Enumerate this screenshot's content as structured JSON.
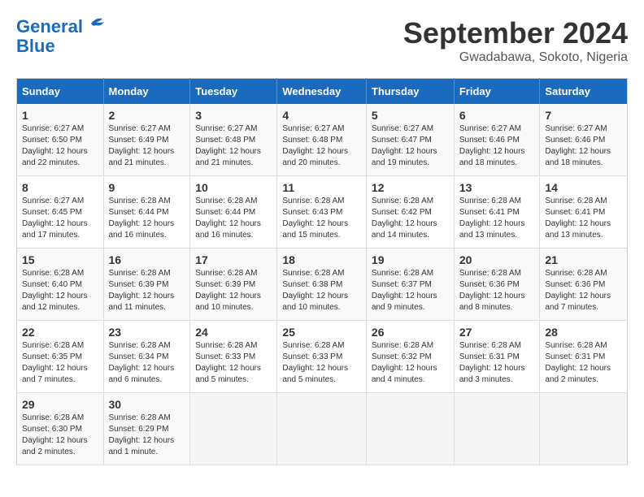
{
  "header": {
    "logo_line1": "General",
    "logo_line2": "Blue",
    "month": "September 2024",
    "location": "Gwadabawa, Sokoto, Nigeria"
  },
  "weekdays": [
    "Sunday",
    "Monday",
    "Tuesday",
    "Wednesday",
    "Thursday",
    "Friday",
    "Saturday"
  ],
  "weeks": [
    [
      {
        "day": "1",
        "sunrise": "6:27 AM",
        "sunset": "6:50 PM",
        "daylight": "12 hours and 22 minutes."
      },
      {
        "day": "2",
        "sunrise": "6:27 AM",
        "sunset": "6:49 PM",
        "daylight": "12 hours and 21 minutes."
      },
      {
        "day": "3",
        "sunrise": "6:27 AM",
        "sunset": "6:48 PM",
        "daylight": "12 hours and 21 minutes."
      },
      {
        "day": "4",
        "sunrise": "6:27 AM",
        "sunset": "6:48 PM",
        "daylight": "12 hours and 20 minutes."
      },
      {
        "day": "5",
        "sunrise": "6:27 AM",
        "sunset": "6:47 PM",
        "daylight": "12 hours and 19 minutes."
      },
      {
        "day": "6",
        "sunrise": "6:27 AM",
        "sunset": "6:46 PM",
        "daylight": "12 hours and 18 minutes."
      },
      {
        "day": "7",
        "sunrise": "6:27 AM",
        "sunset": "6:46 PM",
        "daylight": "12 hours and 18 minutes."
      }
    ],
    [
      {
        "day": "8",
        "sunrise": "6:27 AM",
        "sunset": "6:45 PM",
        "daylight": "12 hours and 17 minutes."
      },
      {
        "day": "9",
        "sunrise": "6:28 AM",
        "sunset": "6:44 PM",
        "daylight": "12 hours and 16 minutes."
      },
      {
        "day": "10",
        "sunrise": "6:28 AM",
        "sunset": "6:44 PM",
        "daylight": "12 hours and 16 minutes."
      },
      {
        "day": "11",
        "sunrise": "6:28 AM",
        "sunset": "6:43 PM",
        "daylight": "12 hours and 15 minutes."
      },
      {
        "day": "12",
        "sunrise": "6:28 AM",
        "sunset": "6:42 PM",
        "daylight": "12 hours and 14 minutes."
      },
      {
        "day": "13",
        "sunrise": "6:28 AM",
        "sunset": "6:41 PM",
        "daylight": "12 hours and 13 minutes."
      },
      {
        "day": "14",
        "sunrise": "6:28 AM",
        "sunset": "6:41 PM",
        "daylight": "12 hours and 13 minutes."
      }
    ],
    [
      {
        "day": "15",
        "sunrise": "6:28 AM",
        "sunset": "6:40 PM",
        "daylight": "12 hours and 12 minutes."
      },
      {
        "day": "16",
        "sunrise": "6:28 AM",
        "sunset": "6:39 PM",
        "daylight": "12 hours and 11 minutes."
      },
      {
        "day": "17",
        "sunrise": "6:28 AM",
        "sunset": "6:39 PM",
        "daylight": "12 hours and 10 minutes."
      },
      {
        "day": "18",
        "sunrise": "6:28 AM",
        "sunset": "6:38 PM",
        "daylight": "12 hours and 10 minutes."
      },
      {
        "day": "19",
        "sunrise": "6:28 AM",
        "sunset": "6:37 PM",
        "daylight": "12 hours and 9 minutes."
      },
      {
        "day": "20",
        "sunrise": "6:28 AM",
        "sunset": "6:36 PM",
        "daylight": "12 hours and 8 minutes."
      },
      {
        "day": "21",
        "sunrise": "6:28 AM",
        "sunset": "6:36 PM",
        "daylight": "12 hours and 7 minutes."
      }
    ],
    [
      {
        "day": "22",
        "sunrise": "6:28 AM",
        "sunset": "6:35 PM",
        "daylight": "12 hours and 7 minutes."
      },
      {
        "day": "23",
        "sunrise": "6:28 AM",
        "sunset": "6:34 PM",
        "daylight": "12 hours and 6 minutes."
      },
      {
        "day": "24",
        "sunrise": "6:28 AM",
        "sunset": "6:33 PM",
        "daylight": "12 hours and 5 minutes."
      },
      {
        "day": "25",
        "sunrise": "6:28 AM",
        "sunset": "6:33 PM",
        "daylight": "12 hours and 5 minutes."
      },
      {
        "day": "26",
        "sunrise": "6:28 AM",
        "sunset": "6:32 PM",
        "daylight": "12 hours and 4 minutes."
      },
      {
        "day": "27",
        "sunrise": "6:28 AM",
        "sunset": "6:31 PM",
        "daylight": "12 hours and 3 minutes."
      },
      {
        "day": "28",
        "sunrise": "6:28 AM",
        "sunset": "6:31 PM",
        "daylight": "12 hours and 2 minutes."
      }
    ],
    [
      {
        "day": "29",
        "sunrise": "6:28 AM",
        "sunset": "6:30 PM",
        "daylight": "12 hours and 2 minutes."
      },
      {
        "day": "30",
        "sunrise": "6:28 AM",
        "sunset": "6:29 PM",
        "daylight": "12 hours and 1 minute."
      },
      null,
      null,
      null,
      null,
      null
    ]
  ]
}
